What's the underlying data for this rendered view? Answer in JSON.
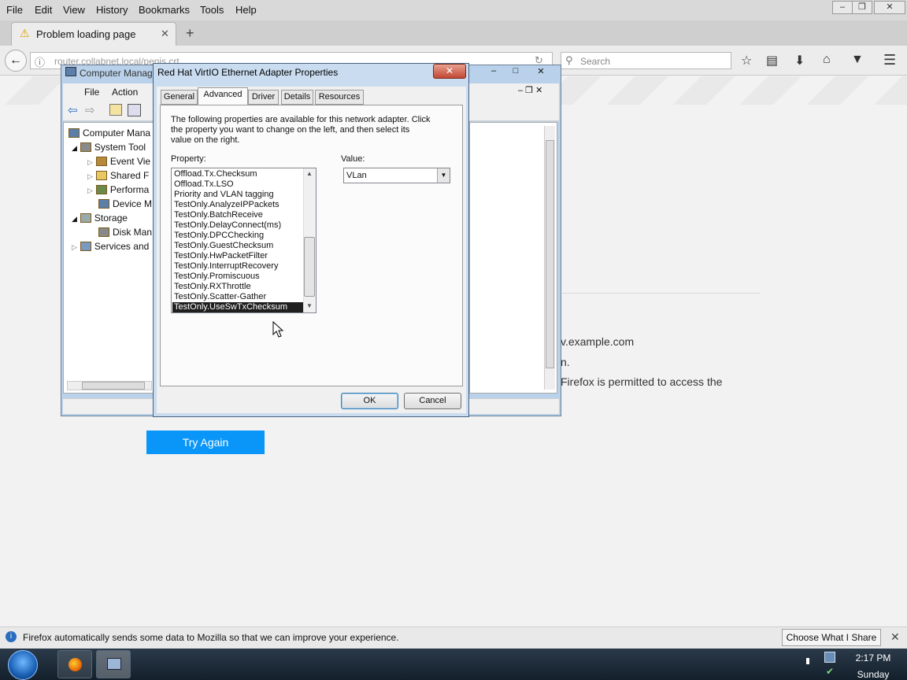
{
  "firefox": {
    "menu": [
      "File",
      "Edit",
      "View",
      "History",
      "Bookmarks",
      "Tools",
      "Help"
    ],
    "tab_title": "Problem loading page",
    "url": "router.collabnet.local/penis.crt",
    "search_placeholder": "Search",
    "page_fragments": {
      "example": "v.example.com",
      "line2": "n.",
      "line3": "Firefox is permitted to access the"
    },
    "try_again": "Try Again",
    "notification": "Firefox automatically sends some data to Mozilla so that we can improve your experience.",
    "notification_button": "Choose What I Share"
  },
  "computer_management": {
    "title": "Computer Manag",
    "menu": [
      "File",
      "Action"
    ],
    "tree": [
      {
        "label": "Computer Mana",
        "level": 0
      },
      {
        "label": "System Tool",
        "level": 1
      },
      {
        "label": "Event Vie",
        "level": 2
      },
      {
        "label": "Shared F",
        "level": 2
      },
      {
        "label": "Performa",
        "level": 2
      },
      {
        "label": "Device M",
        "level": 2
      },
      {
        "label": "Storage",
        "level": 1
      },
      {
        "label": "Disk Man",
        "level": 2
      },
      {
        "label": "Services and",
        "level": 1
      }
    ]
  },
  "dialog": {
    "title": "Red Hat VirtIO Ethernet Adapter Properties",
    "tabs": [
      "General",
      "Advanced",
      "Driver",
      "Details",
      "Resources"
    ],
    "active_tab": "Advanced",
    "description": "The following properties are available for this network adapter. Click the property you want to change on the left, and then select its value on the right.",
    "property_label": "Property:",
    "value_label": "Value:",
    "properties": [
      "Offload.Tx.Checksum",
      "Offload.Tx.LSO",
      "Priority and VLAN tagging",
      "TestOnly.AnalyzeIPPackets",
      "TestOnly.BatchReceive",
      "TestOnly.DelayConnect(ms)",
      "TestOnly.DPCChecking",
      "TestOnly.GuestChecksum",
      "TestOnly.HwPacketFilter",
      "TestOnly.InterruptRecovery",
      "TestOnly.Promiscuous",
      "TestOnly.RXThrottle",
      "TestOnly.Scatter-Gather",
      "TestOnly.UseSwTxChecksum"
    ],
    "selected_property": "TestOnly.UseSwTxChecksum",
    "value": "VLan",
    "ok": "OK",
    "cancel": "Cancel"
  },
  "taskbar": {
    "time": "2:17 PM",
    "day": "Sunday"
  }
}
